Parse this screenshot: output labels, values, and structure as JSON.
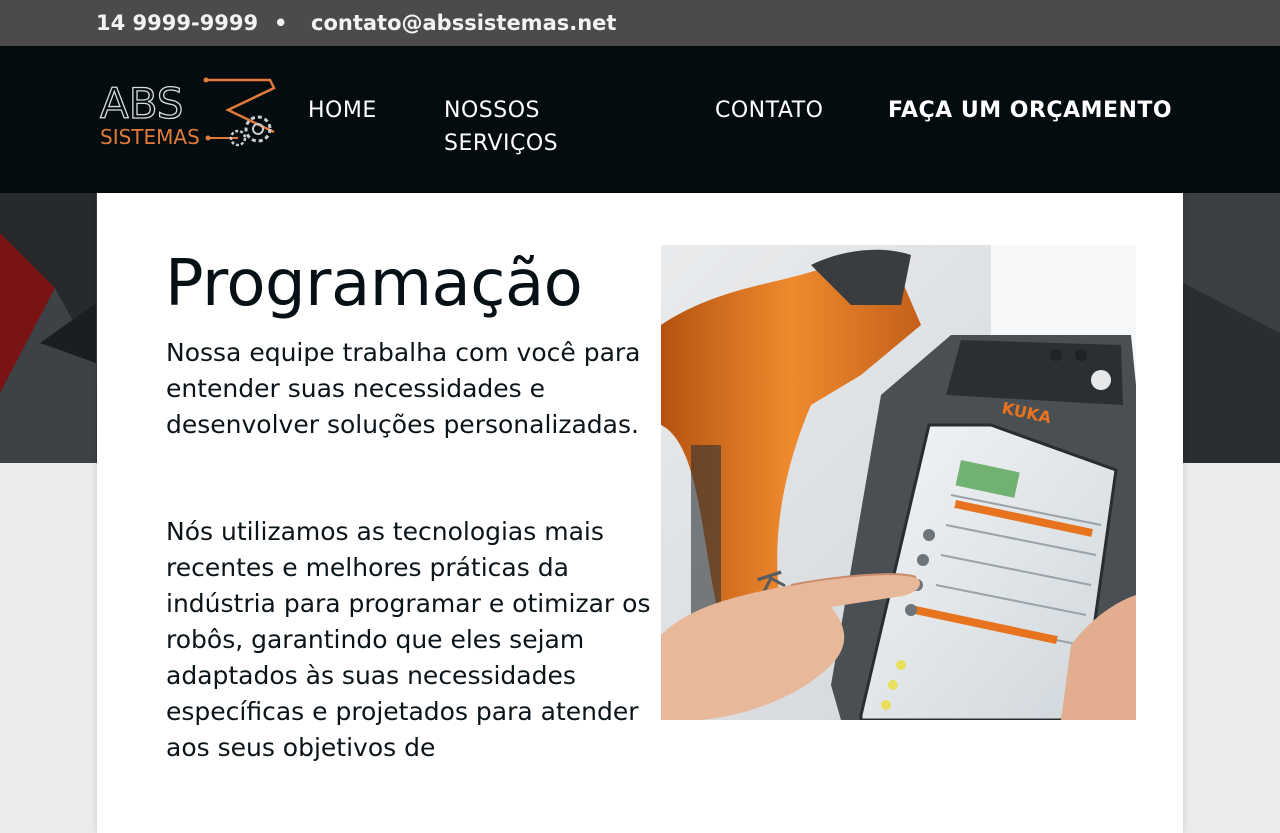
{
  "topbar": {
    "phone": "14 9999-9999",
    "separator": "•",
    "email": "contato@abssistemas.net"
  },
  "logo": {
    "text_main": "ABS",
    "text_sub": "SISTEMAS"
  },
  "nav": {
    "home": "HOME",
    "servicos": "NOSSOS SERVIÇOS",
    "contato": "CONTATO",
    "orcamento": "FAÇA UM ORÇAMENTO"
  },
  "content": {
    "title": "Programação",
    "paragraph1": "Nossa equipe trabalha com você para entender suas necessidades e desenvolver soluções personalizadas.",
    "paragraph2": "Nós utilizamos as tecnologias mais recentes e melhores práticas da indústria para programar e otimizar os robôs, garantindo que eles sejam adaptados às suas necessidades específicas e projetados para atender aos seus objetivos de",
    "photo_brand": "KUKA"
  },
  "colors": {
    "topbar_bg": "#4b4b4b",
    "header_bg": "#040c10",
    "logo_accent": "#e07b39",
    "robot_orange": "#e8731f"
  }
}
